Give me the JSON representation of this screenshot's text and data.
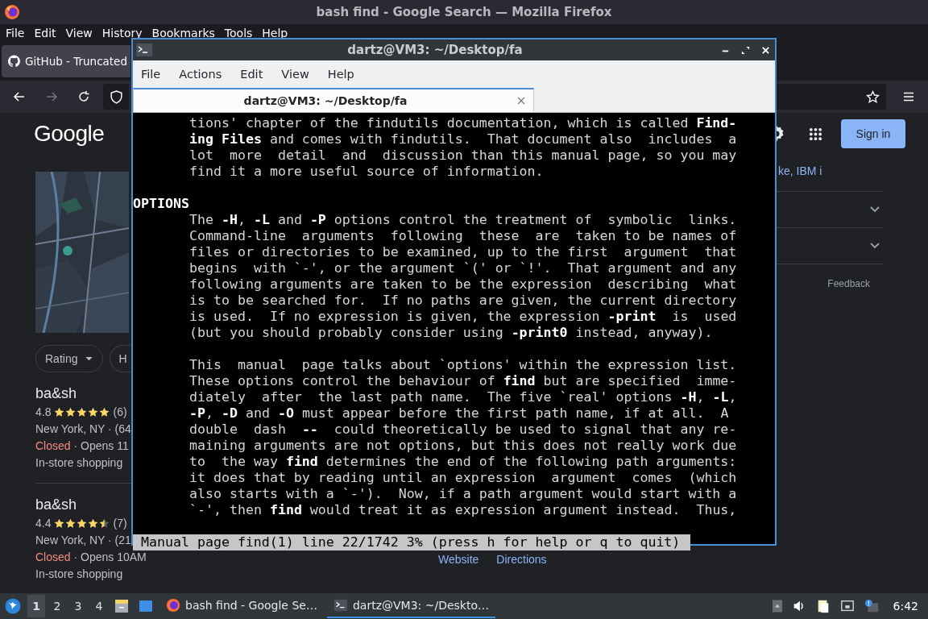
{
  "firefox": {
    "title": "bash find - Google Search — Mozilla Firefox",
    "menu": [
      "File",
      "Edit",
      "View",
      "History",
      "Bookmarks",
      "Tools",
      "Help"
    ],
    "tabs": [
      {
        "label": "GitHub - Truncated",
        "selected": true
      }
    ]
  },
  "google": {
    "logo": "Google",
    "sign_in": "Sign in",
    "filters": [
      "Rating",
      "H"
    ],
    "results": [
      {
        "name": "ba&sh",
        "rating": "4.8",
        "stars": 5,
        "count": "(6)",
        "location": "New York, NY · (64",
        "status": "Closed",
        "hours": "· Opens 11",
        "service": "In-store shopping"
      },
      {
        "name": "ba&sh",
        "rating": "4.4",
        "stars": 4.5,
        "count": "(7)",
        "location": "New York, NY · (21",
        "status": "Closed",
        "hours": "· Opens 10AM",
        "service": "In-store shopping"
      }
    ],
    "side_link": "ke, IBM i",
    "feedback": "Feedback",
    "actions": [
      "Website",
      "Directions"
    ]
  },
  "terminal": {
    "title": "dartz@VM3: ~/Desktop/fa",
    "menu": [
      "File",
      "Actions",
      "Edit",
      "View",
      "Help"
    ],
    "tabs": [
      {
        "label": "dartz@VM3: ~/Desktop/fa",
        "selected": true
      }
    ],
    "blocks": [
      {
        "kind": "paragraph",
        "lines": [
          "tions' chapter of the findutils documentation, which is called **Find-**",
          "**ing Files** and comes with findutils.  That document also  includes  a",
          "lot  more  detail  and  discussion than this manual page, so you may",
          "find it a more useful source of information."
        ]
      },
      {
        "kind": "heading",
        "text": "OPTIONS"
      },
      {
        "kind": "paragraph",
        "lines": [
          "The **-H**, **-L** and **-P** options control the treatment of  symbolic  links.",
          "Command-line  arguments  following  these  are  taken to be names of",
          "files or directories to be examined, up to the first  argument  that",
          "begins  with `-', or the argument `(' or `!'.  That argument and any",
          "following arguments are taken to be the expression  describing  what",
          "is to be searched for.  If no paths are given, the current directory",
          "is used.  If no expression is given, the expression **-print**  is  used",
          "(but you should probably consider using **-print0** instead, anyway)."
        ]
      },
      {
        "kind": "paragraph",
        "lines": [
          "This  manual  page talks about `options' within the expression list.",
          "These options control the behaviour of **find** but are specified  imme-",
          "diately  after  the last path name.  The five `real' options **-H**, **-L**,",
          "**-P**, **-D** and **-O** must appear before the first path name, if at all.  A",
          "double  dash  **--**  could theoretically be used to signal that any re-",
          "maining arguments are not options, but this does not really work due",
          "to  the way **find** determines the end of the following path arguments:",
          "it does that by reading until an expression  argument  comes  (which",
          "also starts with a `-').  Now, if a path argument would start with a",
          "`-', then **find** would treat it as expression argument instead.  Thus,"
        ]
      }
    ],
    "status": "Manual page find(1) line 22/1742 3% (press h for help or q to quit)"
  },
  "taskbar": {
    "workspaces": [
      {
        "label": "1",
        "selected": true
      },
      {
        "label": "2",
        "selected": false
      },
      {
        "label": "3",
        "selected": false
      },
      {
        "label": "4",
        "selected": false
      }
    ],
    "tasks": [
      {
        "kind": "browser",
        "label": "bash find - Google Se…",
        "selected": false
      },
      {
        "kind": "terminal",
        "label": "dartz@VM3: ~/Deskto…",
        "selected": true
      }
    ],
    "clock": "6:42"
  }
}
